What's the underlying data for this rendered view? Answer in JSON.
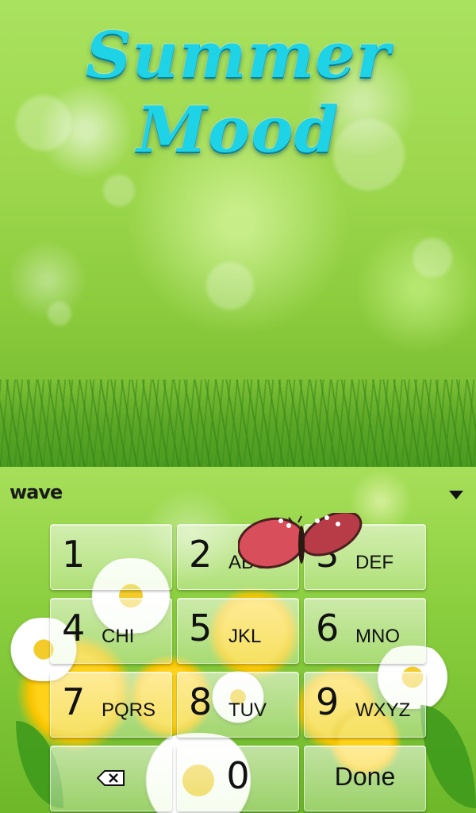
{
  "wallpaper": {
    "title": "Summer Mood"
  },
  "dialer": {
    "brand": "wave",
    "keys": [
      {
        "num": "1",
        "letters": ""
      },
      {
        "num": "2",
        "letters": "ABC"
      },
      {
        "num": "3",
        "letters": "DEF"
      },
      {
        "num": "4",
        "letters": "CHI"
      },
      {
        "num": "5",
        "letters": "JKL"
      },
      {
        "num": "6",
        "letters": "MNO"
      },
      {
        "num": "7",
        "letters": "PQRS"
      },
      {
        "num": "8",
        "letters": "TUV"
      },
      {
        "num": "9",
        "letters": "WXYZ"
      }
    ],
    "zero": "0",
    "done": "Done",
    "icons": [
      "backspace-icon",
      "collapse-icon",
      "butterfly-decoration"
    ]
  },
  "colors": {
    "title": "#1fd3e6",
    "panel": "#8bcf3f",
    "key_text": "#111111"
  }
}
